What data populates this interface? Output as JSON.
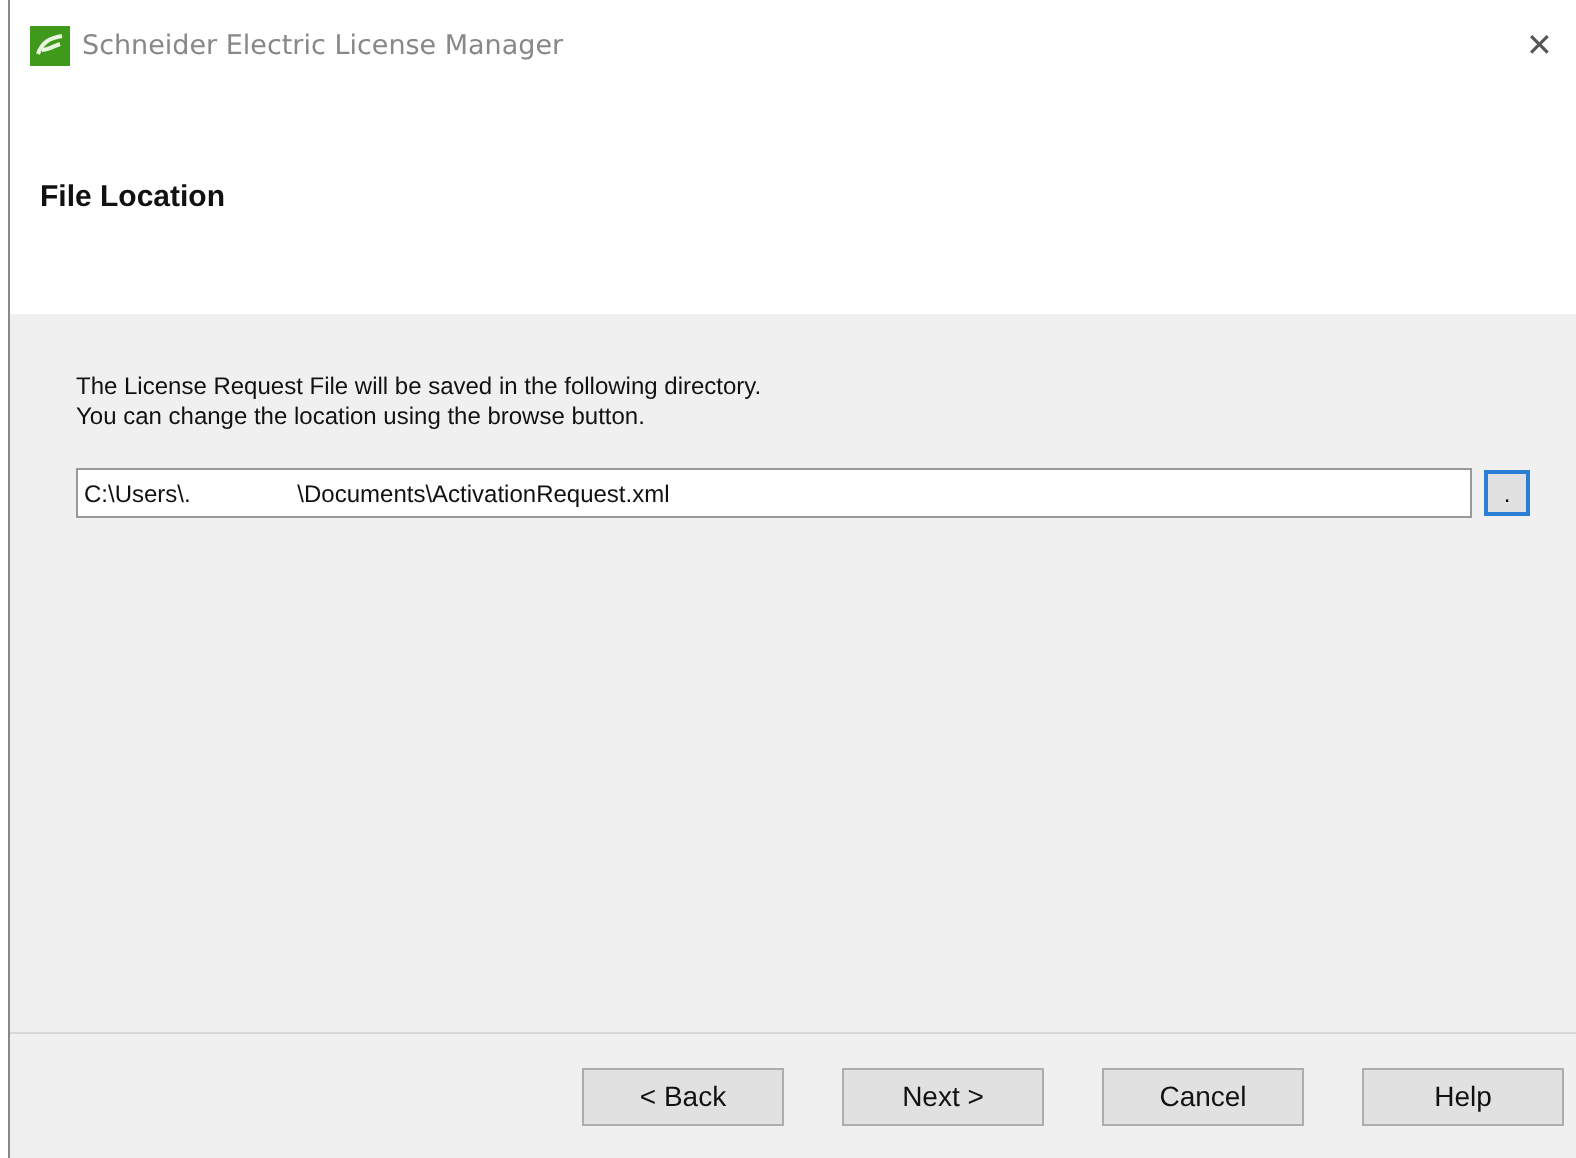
{
  "window": {
    "title": "Schneider Electric License Manager",
    "close": "✕"
  },
  "header": {
    "title": "File Location"
  },
  "body": {
    "lines": [
      "The License Request File will be saved in the following directory.",
      "You can change the location using the browse button."
    ],
    "path_field": {
      "value": "C:\\Users\\.                \\Documents\\ActivationRequest.xml"
    },
    "browse_button": {
      "label": "."
    }
  },
  "buttons": [
    {
      "label": "< Back",
      "disabled": false
    },
    {
      "label": "Next >",
      "disabled": false
    },
    {
      "label": "Cancel",
      "disabled": false
    },
    {
      "label": "Help",
      "disabled": false
    }
  ]
}
